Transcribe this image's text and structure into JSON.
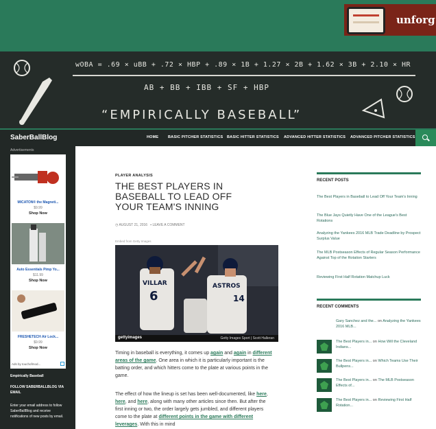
{
  "top_ad": {
    "word": "unforg"
  },
  "header": {
    "formula_top": "wOBA = .69 × uBB + .72 × HBP + .89 × 1B + 1.27 × 2B + 1.62 × 3B + 2.10 × HR",
    "formula_bottom": "AB + BB + IBB + SF + HBP",
    "title": "“EMPIRICALLY BASEBALL”"
  },
  "nav": {
    "brand": "SaberBallBlog",
    "items": [
      "HOME",
      "BASIC PITCHER STATISTICS",
      "BASIC HITTER STATISTICS",
      "ADVANCED HITTER STATISTICS",
      "ADVANCED PITCHER STATISTICS"
    ]
  },
  "left_sidebar": {
    "ad_label": "Advertisements",
    "ads": [
      {
        "name": "MICATON® the Magneti...",
        "price": "$9.99",
        "shop": "Shop Now"
      },
      {
        "name": "Auto Essentials Pimp Yo...",
        "price": "$11.99",
        "shop": "Shop Now"
      },
      {
        "name": "FRESHETECH Air Lock...",
        "price": "$9.99",
        "shop": "Shop Now"
      }
    ],
    "ad_footer": "Ads by touchofmod...",
    "section1": "Empirically Baseball",
    "follow_title": "FOLLOW SABERBALLBLOG VIA EMAIL",
    "follow_text": "Enter your email address to follow SaberBallBlog and receive notifications of new posts by email."
  },
  "article": {
    "category": "PLAYER ANALYSIS",
    "title": "THE BEST PLAYERS IN BASEBALL TO LEAD OFF YOUR TEAM'S INNING",
    "date": "AUGUST 21, 2016",
    "comment_link": "LEAVE A COMMENT",
    "embed_label": "Embed from Getty Images",
    "photo_logo": "gettyimages",
    "photo_credit": "Getty Images Sport | Scott Halleran",
    "p1_a": "Timing in baseball is everything, it comes up ",
    "p1_link1": "again",
    "p1_b": " and ",
    "p1_link2": "again",
    "p1_c": " in ",
    "p1_link3": "different areas of the game",
    "p1_d": ". One area in which it is particularly important is the batting order, and which hitters come to the plate at various points in the game.",
    "p2_a": "The effect of how the lineup is set has been well-documented, like ",
    "p2_link1": "here",
    "p2_b": ", ",
    "p2_link2": "here",
    "p2_c": ", and ",
    "p2_link3": "here",
    "p2_d": ", along with many other articles since then. But after the first inning or two, the order largely gets jumbled, and different players come to the plate at ",
    "p2_link4": "different points in the game with different leverages",
    "p2_e": ". With this in mind"
  },
  "recent_posts": {
    "title": "RECENT POSTS",
    "items": [
      "The Best Players in Baseball to Lead Off Your Team's Inning",
      "The Blue Jays Quietly Have One of the League's Best Rotations",
      "Analyzing the Yankees 2016 MLB Trade Deadline by Prospect Surplus Value",
      "The MLB Postseason Effects of Regular Season Performance Against Top of the Rotation Starters",
      "Reviewing First Half Rotation Matchup Luck"
    ]
  },
  "recent_comments": {
    "title": "RECENT COMMENTS",
    "items": [
      {
        "author": "Gary Sanchez and the...",
        "on": " on ",
        "post": "Analyzing the Yankees 2016 MLB..."
      },
      {
        "author": "The Best Players in...",
        "on": " on ",
        "post": "How Will the Cleveland Indians..."
      },
      {
        "author": "The Best Players in...",
        "on": " on ",
        "post": "Which Teams Use Their Bullpens..."
      },
      {
        "author": "The Best Players in...",
        "on": " on ",
        "post": "The MLB Postseason Effects of..."
      },
      {
        "author": "The Best Players in...",
        "on": " on ",
        "post": "Reviewing First Half Rotation..."
      }
    ]
  },
  "colors": {
    "brand_green": "#2a7a5a",
    "chalkboard": "#252c29",
    "link_green": "#2a6a5a"
  }
}
